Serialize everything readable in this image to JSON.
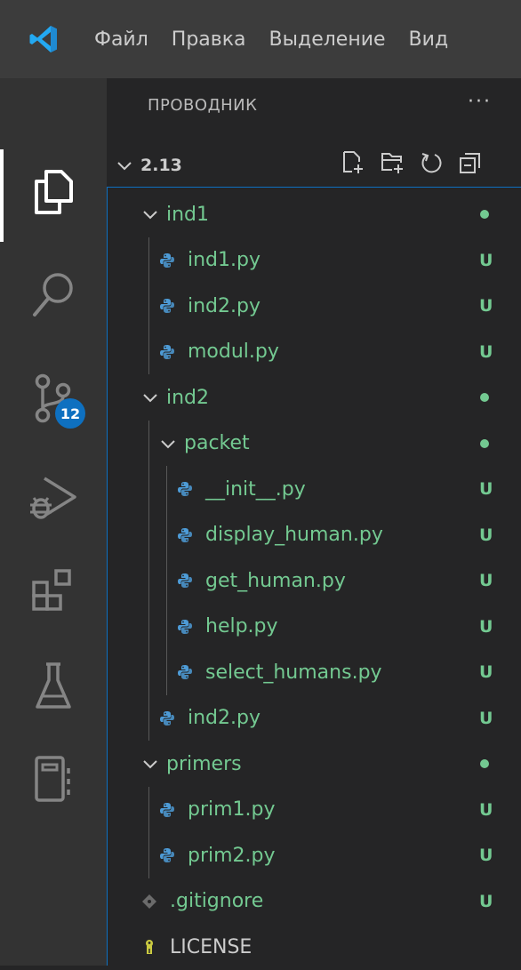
{
  "menu": {
    "items": [
      "Файл",
      "Правка",
      "Выделение",
      "Вид"
    ]
  },
  "activity": {
    "source_control_badge": "12"
  },
  "explorer": {
    "header": "ПРОВОДНИК",
    "more": "···",
    "folder": "2.13",
    "tree": [
      {
        "label": "ind1",
        "kind": "folder",
        "depth": 0,
        "status": "dot"
      },
      {
        "label": "ind1.py",
        "kind": "py",
        "depth": 1,
        "status": "U"
      },
      {
        "label": "ind2.py",
        "kind": "py",
        "depth": 1,
        "status": "U"
      },
      {
        "label": "modul.py",
        "kind": "py",
        "depth": 1,
        "status": "U"
      },
      {
        "label": "ind2",
        "kind": "folder",
        "depth": 0,
        "status": "dot"
      },
      {
        "label": "packet",
        "kind": "folder",
        "depth": 1,
        "status": "dot"
      },
      {
        "label": "__init__.py",
        "kind": "py",
        "depth": 2,
        "status": "U"
      },
      {
        "label": "display_human.py",
        "kind": "py",
        "depth": 2,
        "status": "U"
      },
      {
        "label": "get_human.py",
        "kind": "py",
        "depth": 2,
        "status": "U"
      },
      {
        "label": "help.py",
        "kind": "py",
        "depth": 2,
        "status": "U"
      },
      {
        "label": "select_humans.py",
        "kind": "py",
        "depth": 2,
        "status": "U"
      },
      {
        "label": "ind2.py",
        "kind": "py",
        "depth": 1,
        "status": "U"
      },
      {
        "label": "primers",
        "kind": "folder",
        "depth": 0,
        "status": "dot"
      },
      {
        "label": "prim1.py",
        "kind": "py",
        "depth": 1,
        "status": "U"
      },
      {
        "label": "prim2.py",
        "kind": "py",
        "depth": 1,
        "status": "U"
      },
      {
        "label": ".gitignore",
        "kind": "git",
        "depth": 0,
        "status": "U"
      },
      {
        "label": "LICENSE",
        "kind": "license",
        "depth": 0,
        "status": ""
      }
    ]
  },
  "colors": {
    "untracked": "#73c991",
    "accent": "#0e70c0"
  }
}
